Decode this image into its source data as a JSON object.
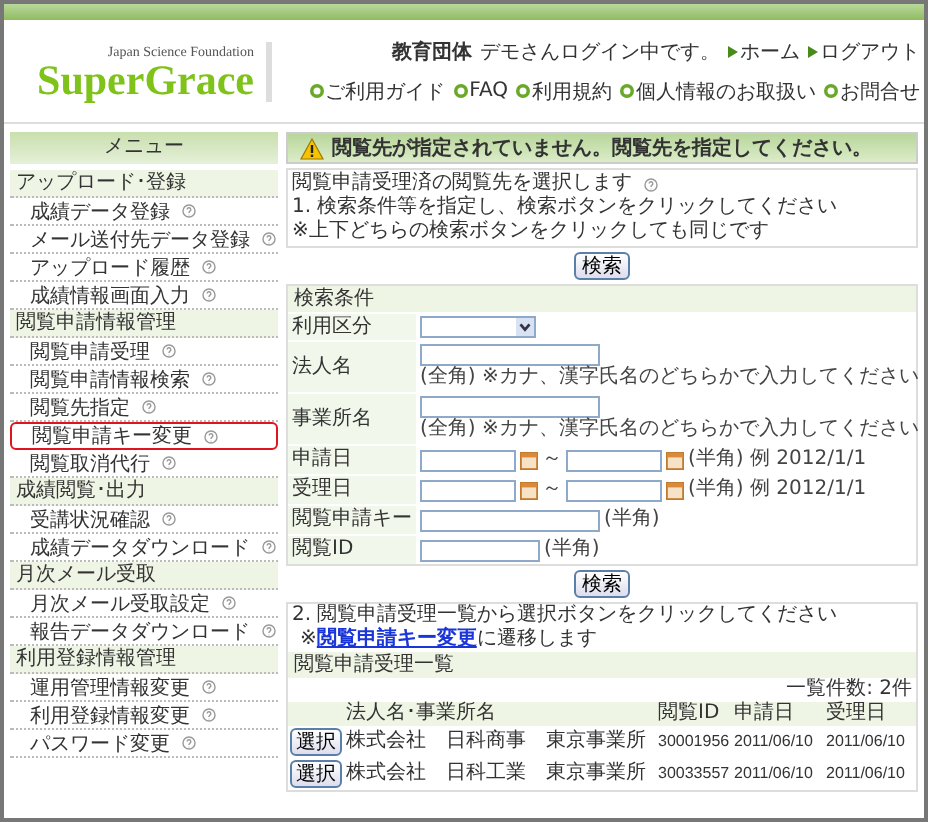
{
  "header": {
    "org": "Japan Science Foundation",
    "logo": "SuperGrace",
    "user_type": "教育団体",
    "login_text": "デモさんログイン中です。",
    "top_links": [
      "ホーム",
      "ログアウト"
    ],
    "nav_links": [
      "ご利用ガイド",
      "FAQ",
      "利用規約",
      "個人情報のお取扱い",
      "お問合せ"
    ]
  },
  "sidebar": {
    "title": "メニュー",
    "sections": [
      {
        "title": "アップロード･登録",
        "items": [
          {
            "label": "成績データ登録",
            "selected": false
          },
          {
            "label": "メール送付先データ登録",
            "selected": false
          },
          {
            "label": "アップロード履歴",
            "selected": false
          },
          {
            "label": "成績情報画面入力",
            "selected": false
          }
        ]
      },
      {
        "title": "閲覧申請情報管理",
        "items": [
          {
            "label": "閲覧申請受理",
            "selected": false
          },
          {
            "label": "閲覧申請情報検索",
            "selected": false
          },
          {
            "label": "閲覧先指定",
            "selected": false
          },
          {
            "label": "閲覧申請キー変更",
            "selected": true
          },
          {
            "label": "閲覧取消代行",
            "selected": false
          }
        ]
      },
      {
        "title": "成績閲覧･出力",
        "items": [
          {
            "label": "受講状況確認",
            "selected": false
          },
          {
            "label": "成績データダウンロード",
            "selected": false
          }
        ]
      },
      {
        "title": "月次メール受取",
        "items": [
          {
            "label": "月次メール受取設定",
            "selected": false
          },
          {
            "label": "報告データダウンロード",
            "selected": false
          }
        ]
      },
      {
        "title": "利用登録情報管理",
        "items": [
          {
            "label": "運用管理情報変更",
            "selected": false
          },
          {
            "label": "利用登録情報変更",
            "selected": false
          },
          {
            "label": "パスワード変更",
            "selected": false
          }
        ]
      }
    ]
  },
  "alert": "閲覧先が指定されていません。閲覧先を指定してください。",
  "intro": {
    "title": "閲覧申請受理済の閲覧先を選択します",
    "step": "1. 検索条件等を指定し、検索ボタンをクリックしてください",
    "note": "※上下どちらの検索ボタンをクリックしても同じです"
  },
  "search_buttons": [
    "検索",
    "検索"
  ],
  "conditions": {
    "title": "検索条件",
    "fields": [
      {
        "kind": "select",
        "label": "利用区分"
      },
      {
        "kind": "text",
        "label": "法人名",
        "note": "(全角) ※カナ、漢字氏名のどちらかで入力してください"
      },
      {
        "kind": "text",
        "label": "事業所名",
        "note": "(全角) ※カナ、漢字氏名のどちらかで入力してください"
      },
      {
        "kind": "daterange",
        "label": "申請日",
        "separator": "～",
        "note": "(半角) 例 2012/1/1"
      },
      {
        "kind": "daterange",
        "label": "受理日",
        "separator": "～",
        "note": "(半角) 例 2012/1/1"
      },
      {
        "kind": "text",
        "label": "閲覧申請キー",
        "note": "(半角)"
      },
      {
        "kind": "short",
        "label": "閲覧ID",
        "note": "(半角)"
      }
    ]
  },
  "step2": {
    "text": "2. 閲覧申請受理一覧から選択ボタンをクリックしてください",
    "prefix": "※",
    "link": "閲覧申請キー変更",
    "suffix": "に遷移します"
  },
  "list": {
    "title": "閲覧申請受理一覧",
    "count": "一覧件数: 2件",
    "columns": [
      "法人名･事業所名",
      "閲覧ID",
      "申請日",
      "受理日"
    ],
    "rows": [
      {
        "button": "選択",
        "name": "株式会社　日科商事　東京事業所",
        "id": "30001956",
        "applied": "2011/06/10",
        "accepted": "2011/06/10"
      },
      {
        "button": "選択",
        "name": "株式会社　日科工業　東京事業所",
        "id": "30033557",
        "applied": "2011/06/10",
        "accepted": "2011/06/10"
      }
    ]
  }
}
